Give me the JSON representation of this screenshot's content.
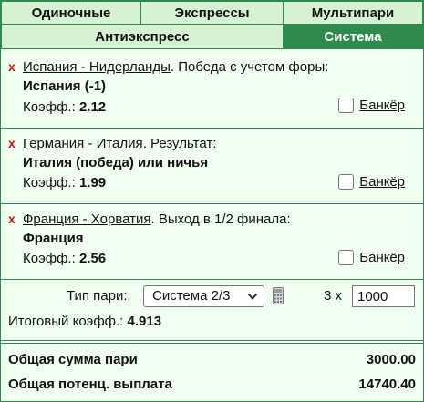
{
  "tabs": {
    "singles": "Одиночные",
    "express": "Экспрессы",
    "multi": "Мультипари",
    "antiexpress": "Антиэкспресс",
    "system": "Система",
    "active": "system"
  },
  "bets": [
    {
      "match": "Испания - Нидерланды",
      "market": ". Победа с учетом форы:",
      "selection": "Испания (-1)",
      "coef_label": "Коэфф.:",
      "coef": "2.12",
      "banker_label": "Банкёр",
      "banker_checked": false
    },
    {
      "match": "Германия - Италия",
      "market": ". Результат:",
      "selection": "Италия (победа) или ничья",
      "coef_label": "Коэфф.:",
      "coef": "1.99",
      "banker_label": "Банкёр",
      "banker_checked": false
    },
    {
      "match": "Франция - Хорватия",
      "market": ". Выход в 1/2 финала:",
      "selection": "Франция",
      "coef_label": "Коэфф.:",
      "coef": "2.56",
      "banker_label": "Банкёр",
      "banker_checked": false
    }
  ],
  "delete_icon": "x",
  "system": {
    "type_label": "Тип пари:",
    "selected": "Система 2/3",
    "multiplier": "3 x",
    "stake": "1000",
    "total_coef_label": "Итоговый коэфф.:",
    "total_coef": "4.913"
  },
  "summary": {
    "total_label": "Общая сумма пари",
    "total_value": "3000.00",
    "payout_label": "Общая потенц. выплата",
    "payout_value": "14740.40"
  },
  "colors": {
    "accent": "#2f8a4e",
    "tab_bg": "#d7f2d3",
    "panel_bg": "#f0fff0",
    "delete": "#cc1111"
  },
  "icons": [
    "delete-x-icon",
    "chevron-down-icon",
    "calculator-icon"
  ]
}
